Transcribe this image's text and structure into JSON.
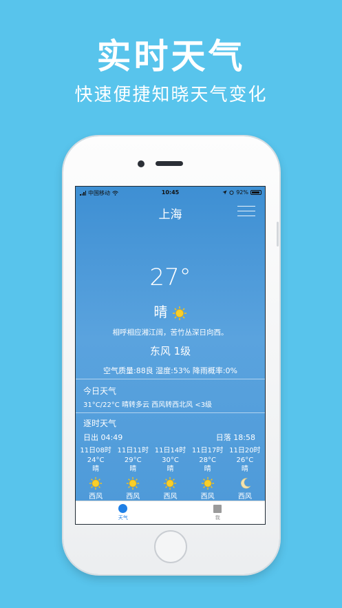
{
  "promo": {
    "title": "实时天气",
    "subtitle": "快速便捷知晓天气变化"
  },
  "statusbar": {
    "carrier": "中国移动",
    "time": "10:45",
    "battery": "92%"
  },
  "nav": {
    "city": "上海",
    "menu_icon": "hamburger-menu-icon"
  },
  "current": {
    "temperature": "27°",
    "condition": "晴",
    "condition_icon": "sun-icon",
    "poem": "相呼相应湘江阔，苦竹丛深日向西。",
    "wind": "东风 1级",
    "air_info": "空气质量:88良 湿度:53% 降雨概率:0%"
  },
  "today": {
    "label": "今日天气",
    "detail": "31°C/22°C 晴转多云 西风转西北风 <3级"
  },
  "hourly_section": {
    "label": "逐时天气",
    "sunrise": "日出 04:49",
    "sunset": "日落 18:58"
  },
  "hourly": [
    {
      "time": "11日08时",
      "temp": "24°C",
      "cond": "晴",
      "icon": "sun-icon",
      "wind": "西风"
    },
    {
      "time": "11日11时",
      "temp": "29°C",
      "cond": "晴",
      "icon": "sun-icon",
      "wind": "西风"
    },
    {
      "time": "11日14时",
      "temp": "30°C",
      "cond": "晴",
      "icon": "sun-icon",
      "wind": "西风"
    },
    {
      "time": "11日17时",
      "temp": "28°C",
      "cond": "晴",
      "icon": "sun-icon",
      "wind": "西风"
    },
    {
      "time": "11日20时",
      "temp": "26°C",
      "cond": "晴",
      "icon": "moon-icon",
      "wind": "西风"
    }
  ],
  "tabbar": {
    "weather_label": "天气",
    "me_label": "我"
  },
  "colors": {
    "background": "#58c4ec",
    "screen_blue": "#4d99d8",
    "tab_active": "#1e7fe6",
    "sun_yellow": "#f5c21b"
  }
}
